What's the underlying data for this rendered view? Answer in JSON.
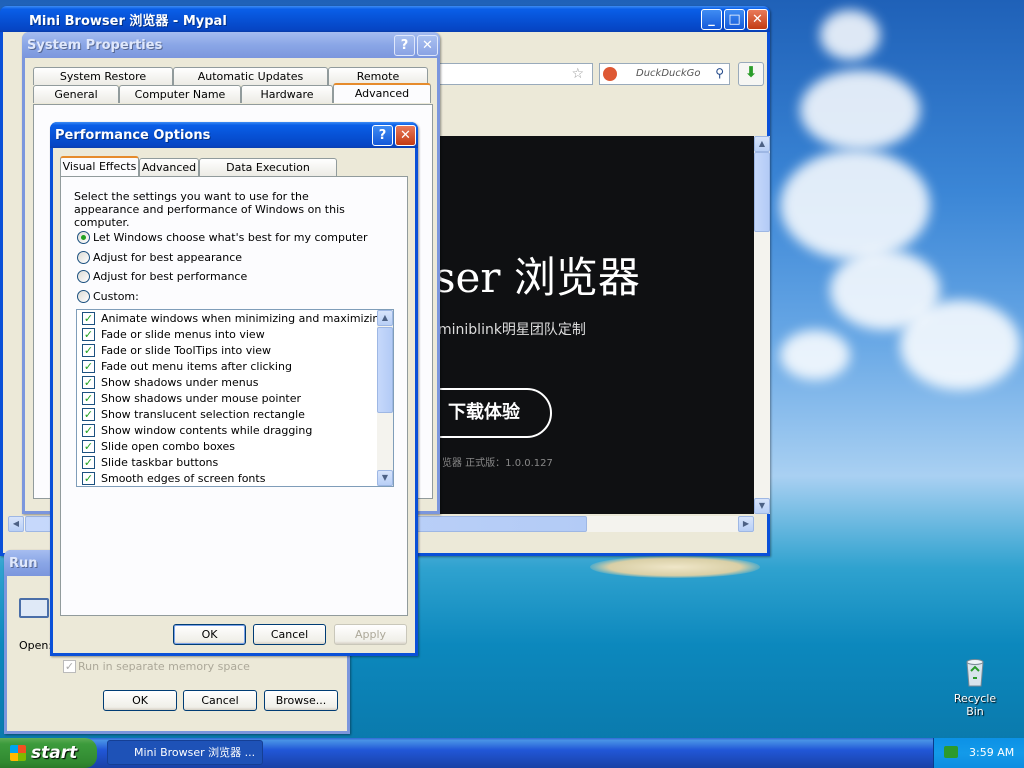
{
  "colors": {
    "titlebar_active": "#0a5fe8",
    "titlebar_inactive": "#7b96dd",
    "dialog_bg": "#ece9d8",
    "browser_page_bg": "#0f1012",
    "checkbox_green": "#21a121"
  },
  "browser": {
    "title": "Mini Browser 浏览器 - Mypal",
    "search_engine_label": "DuckDuckGo",
    "page": {
      "heading": "ser 浏览器",
      "subtitle": "miniblink明星团队定制",
      "download_button": "下载体验",
      "version_text": "览器 正式版：1.0.0.127"
    }
  },
  "system_properties": {
    "title": "System Properties",
    "tabs_row1": [
      "System Restore",
      "Automatic Updates",
      "Remote"
    ],
    "tabs_row2": [
      "General",
      "Computer Name",
      "Hardware",
      "Advanced"
    ],
    "selected_tab": "Advanced"
  },
  "performance_options": {
    "title": "Performance Options",
    "tabs": [
      "Visual Effects",
      "Advanced",
      "Data Execution Prevention"
    ],
    "selected_tab": "Visual Effects",
    "description": "Select the settings you want to use for the appearance and performance of Windows on this computer.",
    "radio_options": [
      {
        "label": "Let Windows choose what's best for my computer",
        "selected": true
      },
      {
        "label": "Adjust for best appearance",
        "selected": false
      },
      {
        "label": "Adjust for best performance",
        "selected": false
      },
      {
        "label": "Custom:",
        "selected": false
      }
    ],
    "effects": [
      {
        "label": "Animate windows when minimizing and maximizing",
        "checked": true
      },
      {
        "label": "Fade or slide menus into view",
        "checked": true
      },
      {
        "label": "Fade or slide ToolTips into view",
        "checked": true
      },
      {
        "label": "Fade out menu items after clicking",
        "checked": true
      },
      {
        "label": "Show shadows under menus",
        "checked": true
      },
      {
        "label": "Show shadows under mouse pointer",
        "checked": true
      },
      {
        "label": "Show translucent selection rectangle",
        "checked": true
      },
      {
        "label": "Show window contents while dragging",
        "checked": true
      },
      {
        "label": "Slide open combo boxes",
        "checked": true
      },
      {
        "label": "Slide taskbar buttons",
        "checked": true
      },
      {
        "label": "Smooth edges of screen fonts",
        "checked": true
      }
    ],
    "ok_label": "OK",
    "cancel_label": "Cancel",
    "apply_label": "Apply"
  },
  "run_dialog": {
    "title": "Run",
    "open_label": "Open:",
    "separate_memory_label": "Run in separate memory space",
    "ok_label": "OK",
    "cancel_label": "Cancel",
    "browse_label": "Browse..."
  },
  "desktop": {
    "recycle_bin_label": "Recycle Bin"
  },
  "taskbar": {
    "start_label": "start",
    "task_label": "Mini Browser 浏览器 ...",
    "clock": "3:59 AM"
  },
  "icons": {
    "minimize": "minimize-icon",
    "maximize": "maximize-icon",
    "close": "close-icon",
    "help": "help-icon",
    "star": "bookmark-star-icon",
    "search": "search-icon",
    "download": "download-icon",
    "recycle_bin": "recycle-bin-icon",
    "run": "run-icon",
    "start": "windows-logo-icon"
  }
}
